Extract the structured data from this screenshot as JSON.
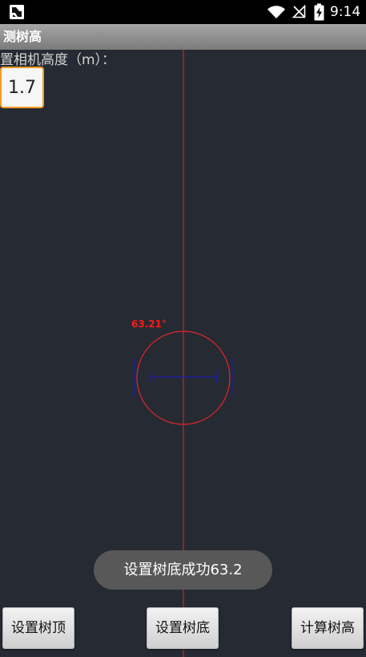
{
  "status_bar": {
    "time": "9:14",
    "icons": [
      "app-notification-icon",
      "wifi-icon",
      "no-signal-icon",
      "battery-charging-icon"
    ]
  },
  "app_bar": {
    "title": "测树高"
  },
  "camera_height": {
    "label": "置相机高度（m）：",
    "value": "1.7"
  },
  "measurement_overlay": {
    "angle": "63.21°"
  },
  "toast": {
    "message": "设置树底成功63.2"
  },
  "buttons": {
    "set_top": "设置树顶",
    "set_bottom": "设置树底",
    "calculate": "计算树高"
  },
  "colors": {
    "background": "#262a32",
    "guide_line": "#e0262b",
    "level_circle": "#e0262b",
    "angle_text": "#ff1a1a",
    "marker": "#1c1ca8",
    "input_border": "#f39a26",
    "toast_background": "#585858"
  }
}
